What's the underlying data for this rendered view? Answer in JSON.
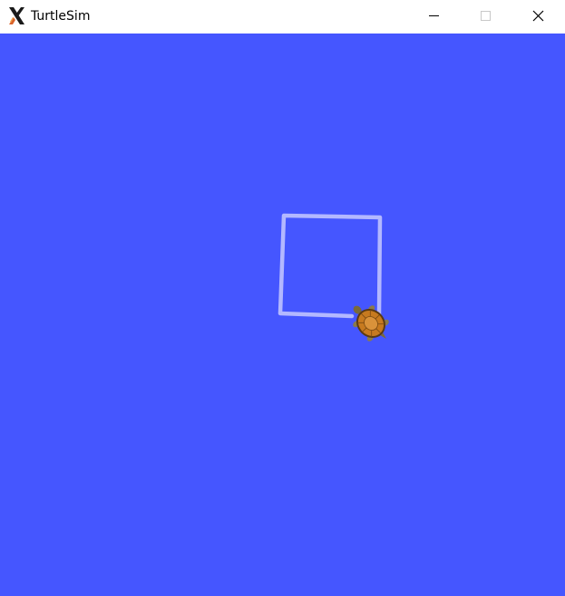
{
  "window": {
    "title": "TurtleSim"
  },
  "titlebar_icons": {
    "app": "x-logo-icon",
    "minimize": "minimize-icon",
    "maximize": "maximize-icon",
    "close": "close-icon"
  },
  "canvas": {
    "background": "#4556ff",
    "pen_color": "#b3b8ff",
    "path": "square",
    "turtle": {
      "icon": "turtle-icon",
      "shell_color": "#c77a1f",
      "body_color": "#7a6a3a"
    }
  }
}
